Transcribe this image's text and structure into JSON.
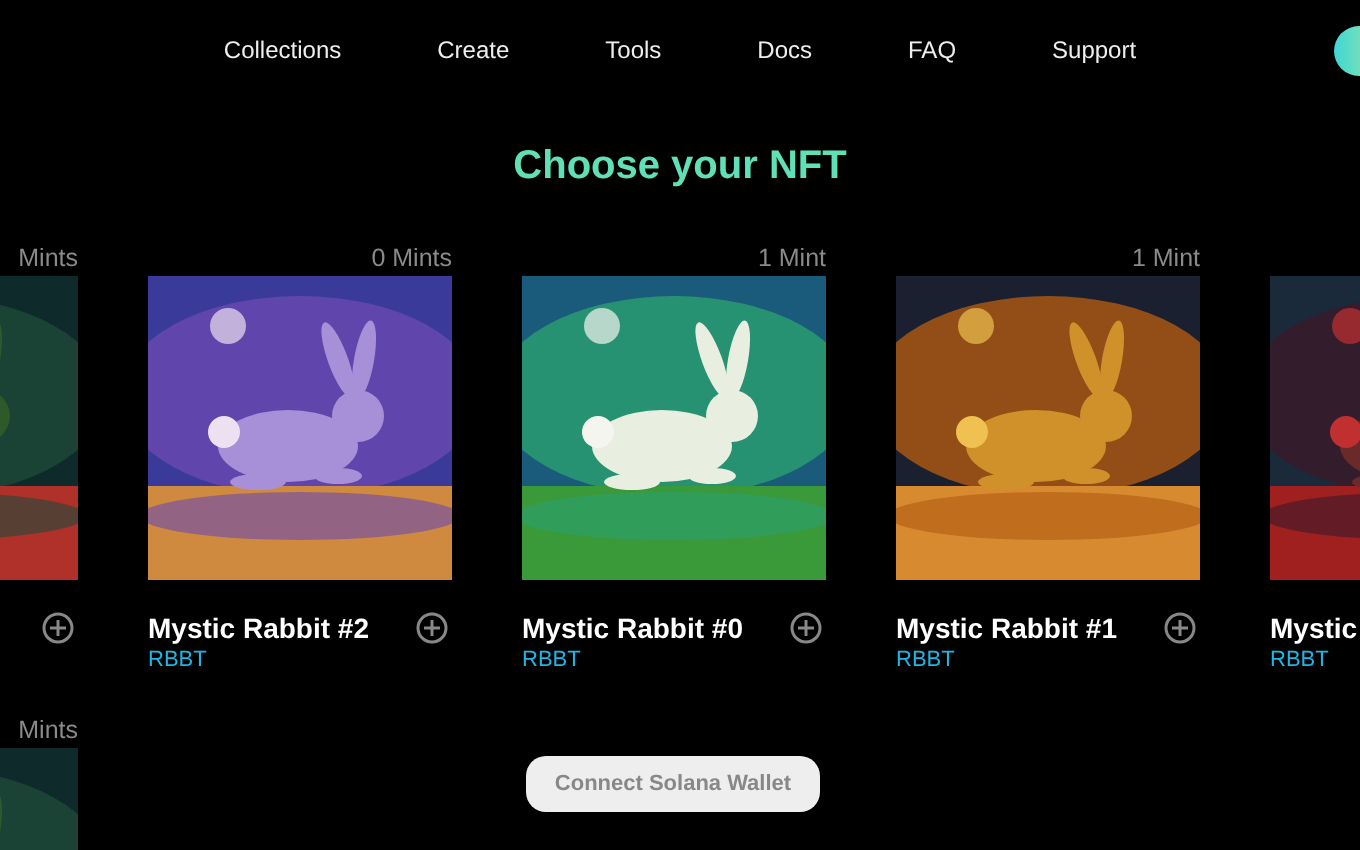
{
  "nav": {
    "links": [
      "Collections",
      "Create",
      "Tools",
      "Docs",
      "FAQ",
      "Support"
    ]
  },
  "heading": "Choose your NFT",
  "rows": [
    {
      "cards": [
        {
          "mints": "Mints"
        },
        {
          "mints": "0 Mints",
          "title": "Mystic Rabbit #2",
          "symbol": "RBBT"
        },
        {
          "mints": "1 Mint",
          "title": "Mystic Rabbit #0",
          "symbol": "RBBT"
        },
        {
          "mints": "1 Mint",
          "title": "Mystic Rabbit #1",
          "symbol": "RBBT"
        },
        {
          "title": "Mystic",
          "symbol": "RBBT"
        }
      ]
    },
    {
      "cards": [
        {
          "mints": "Mints"
        }
      ]
    }
  ],
  "connect_button": "Connect Solana Wallet"
}
